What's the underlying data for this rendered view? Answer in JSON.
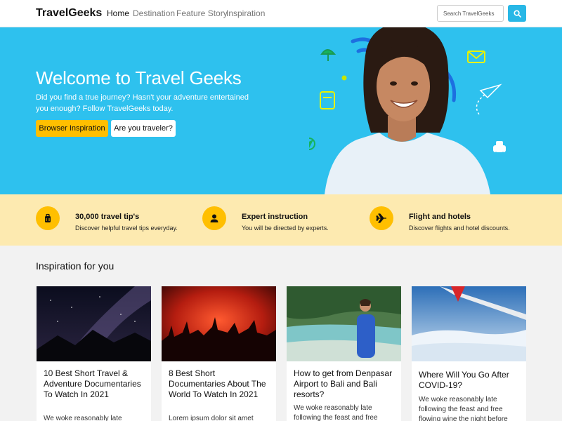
{
  "nav": {
    "brand": "TravelGeeks",
    "links": [
      "Home",
      "Destination",
      "Feature Story",
      "Inspiration"
    ],
    "search_placeholder": "Search TravelGeeks",
    "search_icon": "search-icon"
  },
  "hero": {
    "title": "Welcome to Travel Geeks",
    "subtitle": "Did you find a true journey? Hasn't your adventure entertained you enough? Follow TravelGeeks today.",
    "primary_button": "Browser Inspiration",
    "secondary_button": "Are you traveler?"
  },
  "features": [
    {
      "icon": "suitcase-icon",
      "title": "30,000 travel tip's",
      "desc": "Discover helpful travel tips everyday."
    },
    {
      "icon": "person-icon",
      "title": "Expert instruction",
      "desc": "You will be directed by experts."
    },
    {
      "icon": "airplane-icon",
      "title": "Flight and hotels",
      "desc": "Discover flights and hotel discounts."
    }
  ],
  "inspiration": {
    "heading": "Inspiration for you",
    "cards": [
      {
        "title": "10 Best Short Travel & Adventure Documentaries To Watch In 2021",
        "text": "We woke reasonably late"
      },
      {
        "title": "8 Best Short Documentaries About The World To Watch In 2021",
        "text": "Lorem ipsum dolor sit amet"
      },
      {
        "title": "How to get from Denpasar Airport to Bali and Bali resorts?",
        "text": "We woke reasonably late following the feast and free"
      },
      {
        "title": "Where Will You Go After COVID-19?",
        "text": "We woke reasonably late following the feast and free flowing wine the night before"
      }
    ]
  },
  "colors": {
    "accent": "#2ec1ee",
    "yellow": "#ffbf00",
    "feature_bg": "#fdeab0"
  }
}
